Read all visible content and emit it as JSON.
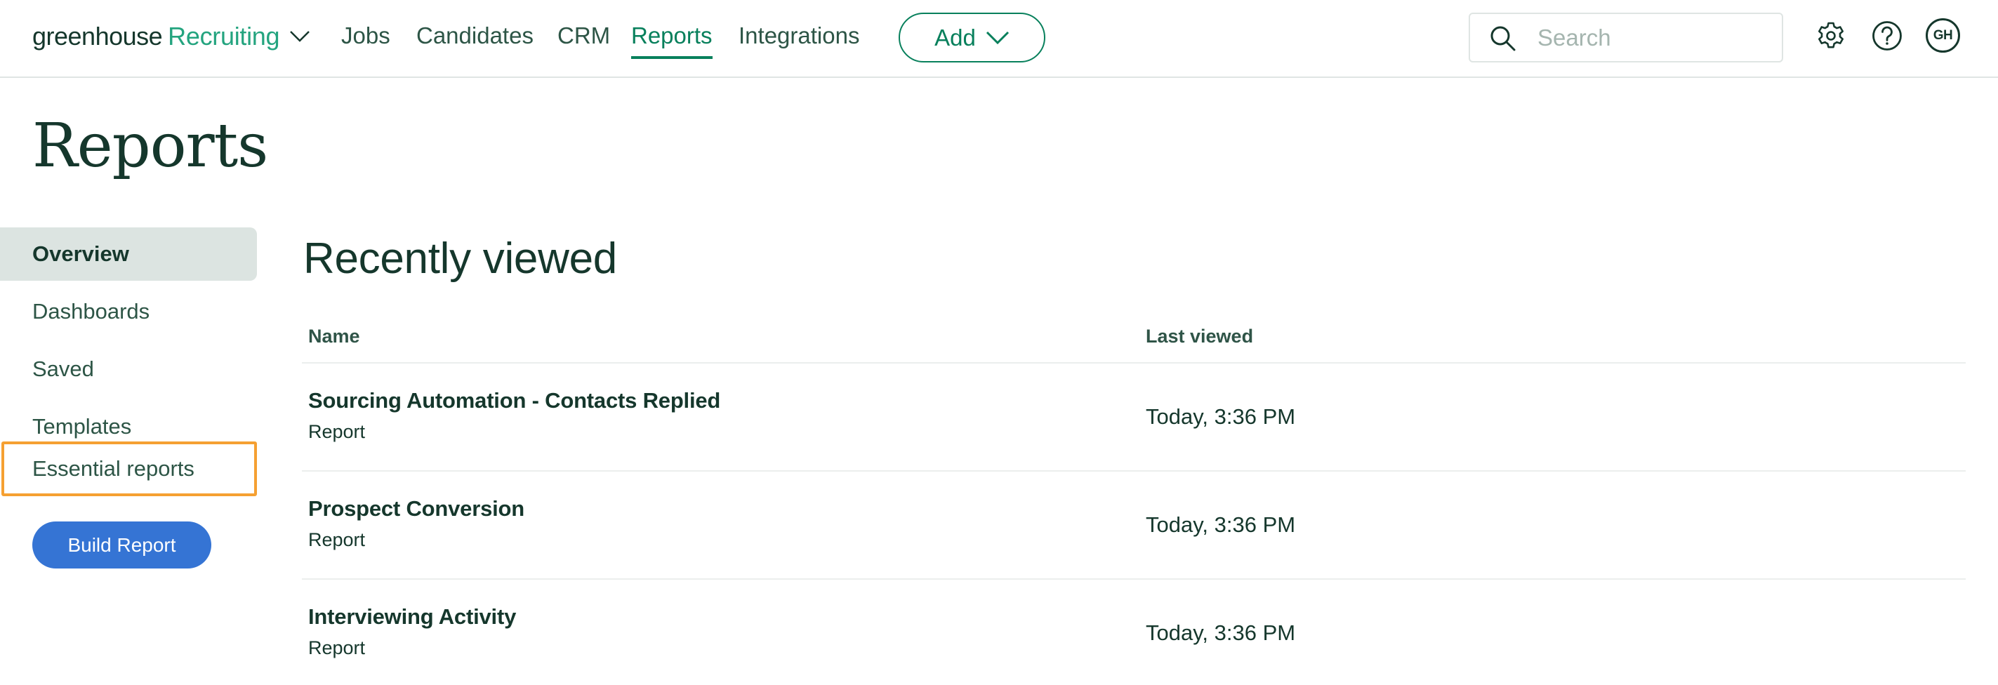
{
  "header": {
    "logo": {
      "brand": "greenhouse",
      "product": "Recruiting"
    },
    "nav": [
      {
        "label": "Jobs",
        "active": false
      },
      {
        "label": "Candidates",
        "active": false
      },
      {
        "label": "CRM",
        "active": false
      },
      {
        "label": "Reports",
        "active": true
      },
      {
        "label": "Integrations",
        "active": false
      }
    ],
    "add_button": "Add",
    "search": {
      "placeholder": "Search",
      "value": ""
    },
    "icons": {
      "settings": "gear-icon",
      "help": "question-circle-icon"
    },
    "avatar_initials": "GH"
  },
  "page": {
    "title": "Reports"
  },
  "sidebar": {
    "items": [
      {
        "label": "Overview",
        "active": true
      },
      {
        "label": "Dashboards",
        "active": false
      },
      {
        "label": "Saved",
        "active": false
      },
      {
        "label": "Templates",
        "active": false
      },
      {
        "label": "Essential reports",
        "active": false,
        "highlighted": true
      }
    ],
    "build_button": "Build Report"
  },
  "main": {
    "section_title": "Recently viewed",
    "columns": [
      "Name",
      "Last viewed"
    ],
    "rows": [
      {
        "name": "Sourcing Automation - Contacts Replied",
        "type": "Report",
        "last_viewed": "Today, 3:36 PM"
      },
      {
        "name": "Prospect Conversion",
        "type": "Report",
        "last_viewed": "Today, 3:36 PM"
      },
      {
        "name": "Interviewing Activity",
        "type": "Report",
        "last_viewed": "Today, 3:36 PM"
      }
    ]
  },
  "colors": {
    "brand_dark": "#15372c",
    "brand_green": "#24a47f",
    "accent_green": "#08805c",
    "primary_blue": "#3574d4",
    "highlight_orange": "#f5a032",
    "active_bg": "#dce4e1"
  }
}
